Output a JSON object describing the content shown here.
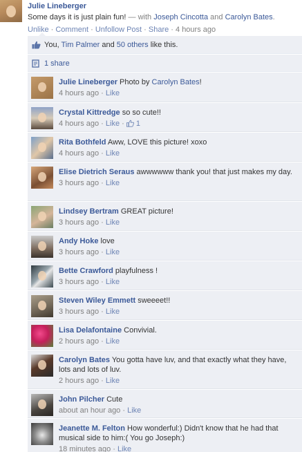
{
  "story": {
    "author": "Julie Lineberger",
    "message": "Some days it is just plain fun!",
    "with_prefix": " — with ",
    "tagged": [
      "Joseph Cincotta",
      "Carolyn Bates"
    ],
    "and_word": " and ",
    "period": ".",
    "actions": {
      "unlike": "Unlike",
      "comment": "Comment",
      "unfollow": "Unfollow Post",
      "share": "Share",
      "time": "4 hours ago",
      "sep": " · "
    }
  },
  "likes": {
    "you": "You, ",
    "person": "Tim Palmer",
    "and_word": " and ",
    "others": "50 others",
    "suffix": " like this."
  },
  "shares": {
    "label": "1 share"
  },
  "colors": {
    "link": "#3b5998",
    "muted_link": "#6d84b4",
    "ufi_background": "#edeff4",
    "meta_text": "#808080"
  },
  "comments": [
    {
      "name": "Julie Lineberger",
      "text": "Photo by ",
      "link_text": "Carolyn Bates",
      "text_after": "!",
      "time": "4 hours ago",
      "like_label": "Like"
    },
    {
      "name": "Crystal Kittredge",
      "text": "so so cute!!",
      "time": "4 hours ago",
      "like_label": "Like",
      "like_count": "1"
    },
    {
      "name": "Rita Bothfeld",
      "text": "Aww, LOVE this picture! xoxo",
      "time": "4 hours ago",
      "like_label": "Like"
    },
    {
      "name": "Elise Dietrich Seraus",
      "text": "awwwwww thank you! that just makes my day.",
      "time": "3 hours ago",
      "like_label": "Like"
    },
    {
      "name": "Lindsey Bertram",
      "text": "GREAT picture!",
      "time": "3 hours ago",
      "like_label": "Like"
    },
    {
      "name": "Andy Hoke",
      "text": "love",
      "time": "3 hours ago",
      "like_label": "Like"
    },
    {
      "name": "Bette Crawford",
      "text": "playfulness !",
      "time": "3 hours ago",
      "like_label": "Like"
    },
    {
      "name": "Steven Wiley Emmett",
      "text": "sweeeet!!",
      "time": "3 hours ago",
      "like_label": "Like"
    },
    {
      "name": "Lisa Delafontaine",
      "text": "Convivial.",
      "time": "2 hours ago",
      "like_label": "Like"
    },
    {
      "name": "Carolyn Bates",
      "text": "You gotta have luv, and that exactly what they have, lots and lots of luv.",
      "time": "2 hours ago",
      "like_label": "Like"
    },
    {
      "name": "John Pilcher",
      "text": "Cute",
      "time": "about an hour ago",
      "like_label": "Like"
    },
    {
      "name": "Jeanette M. Felton",
      "text": "How wonderful:) Didn't know that he had that musical side to him:( You go Joseph:)",
      "time": "18 minutes ago",
      "like_label": "Like"
    }
  ]
}
